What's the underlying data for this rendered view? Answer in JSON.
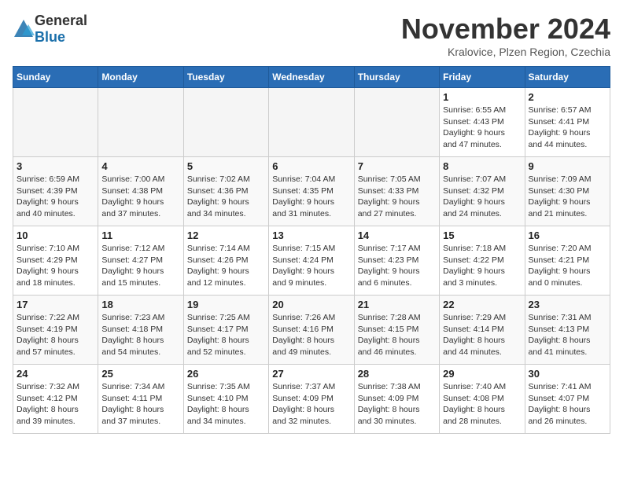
{
  "header": {
    "logo_general": "General",
    "logo_blue": "Blue",
    "month_year": "November 2024",
    "location": "Kralovice, Plzen Region, Czechia"
  },
  "weekdays": [
    "Sunday",
    "Monday",
    "Tuesday",
    "Wednesday",
    "Thursday",
    "Friday",
    "Saturday"
  ],
  "weeks": [
    [
      {
        "day": "",
        "info": ""
      },
      {
        "day": "",
        "info": ""
      },
      {
        "day": "",
        "info": ""
      },
      {
        "day": "",
        "info": ""
      },
      {
        "day": "",
        "info": ""
      },
      {
        "day": "1",
        "info": "Sunrise: 6:55 AM\nSunset: 4:43 PM\nDaylight: 9 hours\nand 47 minutes."
      },
      {
        "day": "2",
        "info": "Sunrise: 6:57 AM\nSunset: 4:41 PM\nDaylight: 9 hours\nand 44 minutes."
      }
    ],
    [
      {
        "day": "3",
        "info": "Sunrise: 6:59 AM\nSunset: 4:39 PM\nDaylight: 9 hours\nand 40 minutes."
      },
      {
        "day": "4",
        "info": "Sunrise: 7:00 AM\nSunset: 4:38 PM\nDaylight: 9 hours\nand 37 minutes."
      },
      {
        "day": "5",
        "info": "Sunrise: 7:02 AM\nSunset: 4:36 PM\nDaylight: 9 hours\nand 34 minutes."
      },
      {
        "day": "6",
        "info": "Sunrise: 7:04 AM\nSunset: 4:35 PM\nDaylight: 9 hours\nand 31 minutes."
      },
      {
        "day": "7",
        "info": "Sunrise: 7:05 AM\nSunset: 4:33 PM\nDaylight: 9 hours\nand 27 minutes."
      },
      {
        "day": "8",
        "info": "Sunrise: 7:07 AM\nSunset: 4:32 PM\nDaylight: 9 hours\nand 24 minutes."
      },
      {
        "day": "9",
        "info": "Sunrise: 7:09 AM\nSunset: 4:30 PM\nDaylight: 9 hours\nand 21 minutes."
      }
    ],
    [
      {
        "day": "10",
        "info": "Sunrise: 7:10 AM\nSunset: 4:29 PM\nDaylight: 9 hours\nand 18 minutes."
      },
      {
        "day": "11",
        "info": "Sunrise: 7:12 AM\nSunset: 4:27 PM\nDaylight: 9 hours\nand 15 minutes."
      },
      {
        "day": "12",
        "info": "Sunrise: 7:14 AM\nSunset: 4:26 PM\nDaylight: 9 hours\nand 12 minutes."
      },
      {
        "day": "13",
        "info": "Sunrise: 7:15 AM\nSunset: 4:24 PM\nDaylight: 9 hours\nand 9 minutes."
      },
      {
        "day": "14",
        "info": "Sunrise: 7:17 AM\nSunset: 4:23 PM\nDaylight: 9 hours\nand 6 minutes."
      },
      {
        "day": "15",
        "info": "Sunrise: 7:18 AM\nSunset: 4:22 PM\nDaylight: 9 hours\nand 3 minutes."
      },
      {
        "day": "16",
        "info": "Sunrise: 7:20 AM\nSunset: 4:21 PM\nDaylight: 9 hours\nand 0 minutes."
      }
    ],
    [
      {
        "day": "17",
        "info": "Sunrise: 7:22 AM\nSunset: 4:19 PM\nDaylight: 8 hours\nand 57 minutes."
      },
      {
        "day": "18",
        "info": "Sunrise: 7:23 AM\nSunset: 4:18 PM\nDaylight: 8 hours\nand 54 minutes."
      },
      {
        "day": "19",
        "info": "Sunrise: 7:25 AM\nSunset: 4:17 PM\nDaylight: 8 hours\nand 52 minutes."
      },
      {
        "day": "20",
        "info": "Sunrise: 7:26 AM\nSunset: 4:16 PM\nDaylight: 8 hours\nand 49 minutes."
      },
      {
        "day": "21",
        "info": "Sunrise: 7:28 AM\nSunset: 4:15 PM\nDaylight: 8 hours\nand 46 minutes."
      },
      {
        "day": "22",
        "info": "Sunrise: 7:29 AM\nSunset: 4:14 PM\nDaylight: 8 hours\nand 44 minutes."
      },
      {
        "day": "23",
        "info": "Sunrise: 7:31 AM\nSunset: 4:13 PM\nDaylight: 8 hours\nand 41 minutes."
      }
    ],
    [
      {
        "day": "24",
        "info": "Sunrise: 7:32 AM\nSunset: 4:12 PM\nDaylight: 8 hours\nand 39 minutes."
      },
      {
        "day": "25",
        "info": "Sunrise: 7:34 AM\nSunset: 4:11 PM\nDaylight: 8 hours\nand 37 minutes."
      },
      {
        "day": "26",
        "info": "Sunrise: 7:35 AM\nSunset: 4:10 PM\nDaylight: 8 hours\nand 34 minutes."
      },
      {
        "day": "27",
        "info": "Sunrise: 7:37 AM\nSunset: 4:09 PM\nDaylight: 8 hours\nand 32 minutes."
      },
      {
        "day": "28",
        "info": "Sunrise: 7:38 AM\nSunset: 4:09 PM\nDaylight: 8 hours\nand 30 minutes."
      },
      {
        "day": "29",
        "info": "Sunrise: 7:40 AM\nSunset: 4:08 PM\nDaylight: 8 hours\nand 28 minutes."
      },
      {
        "day": "30",
        "info": "Sunrise: 7:41 AM\nSunset: 4:07 PM\nDaylight: 8 hours\nand 26 minutes."
      }
    ]
  ]
}
